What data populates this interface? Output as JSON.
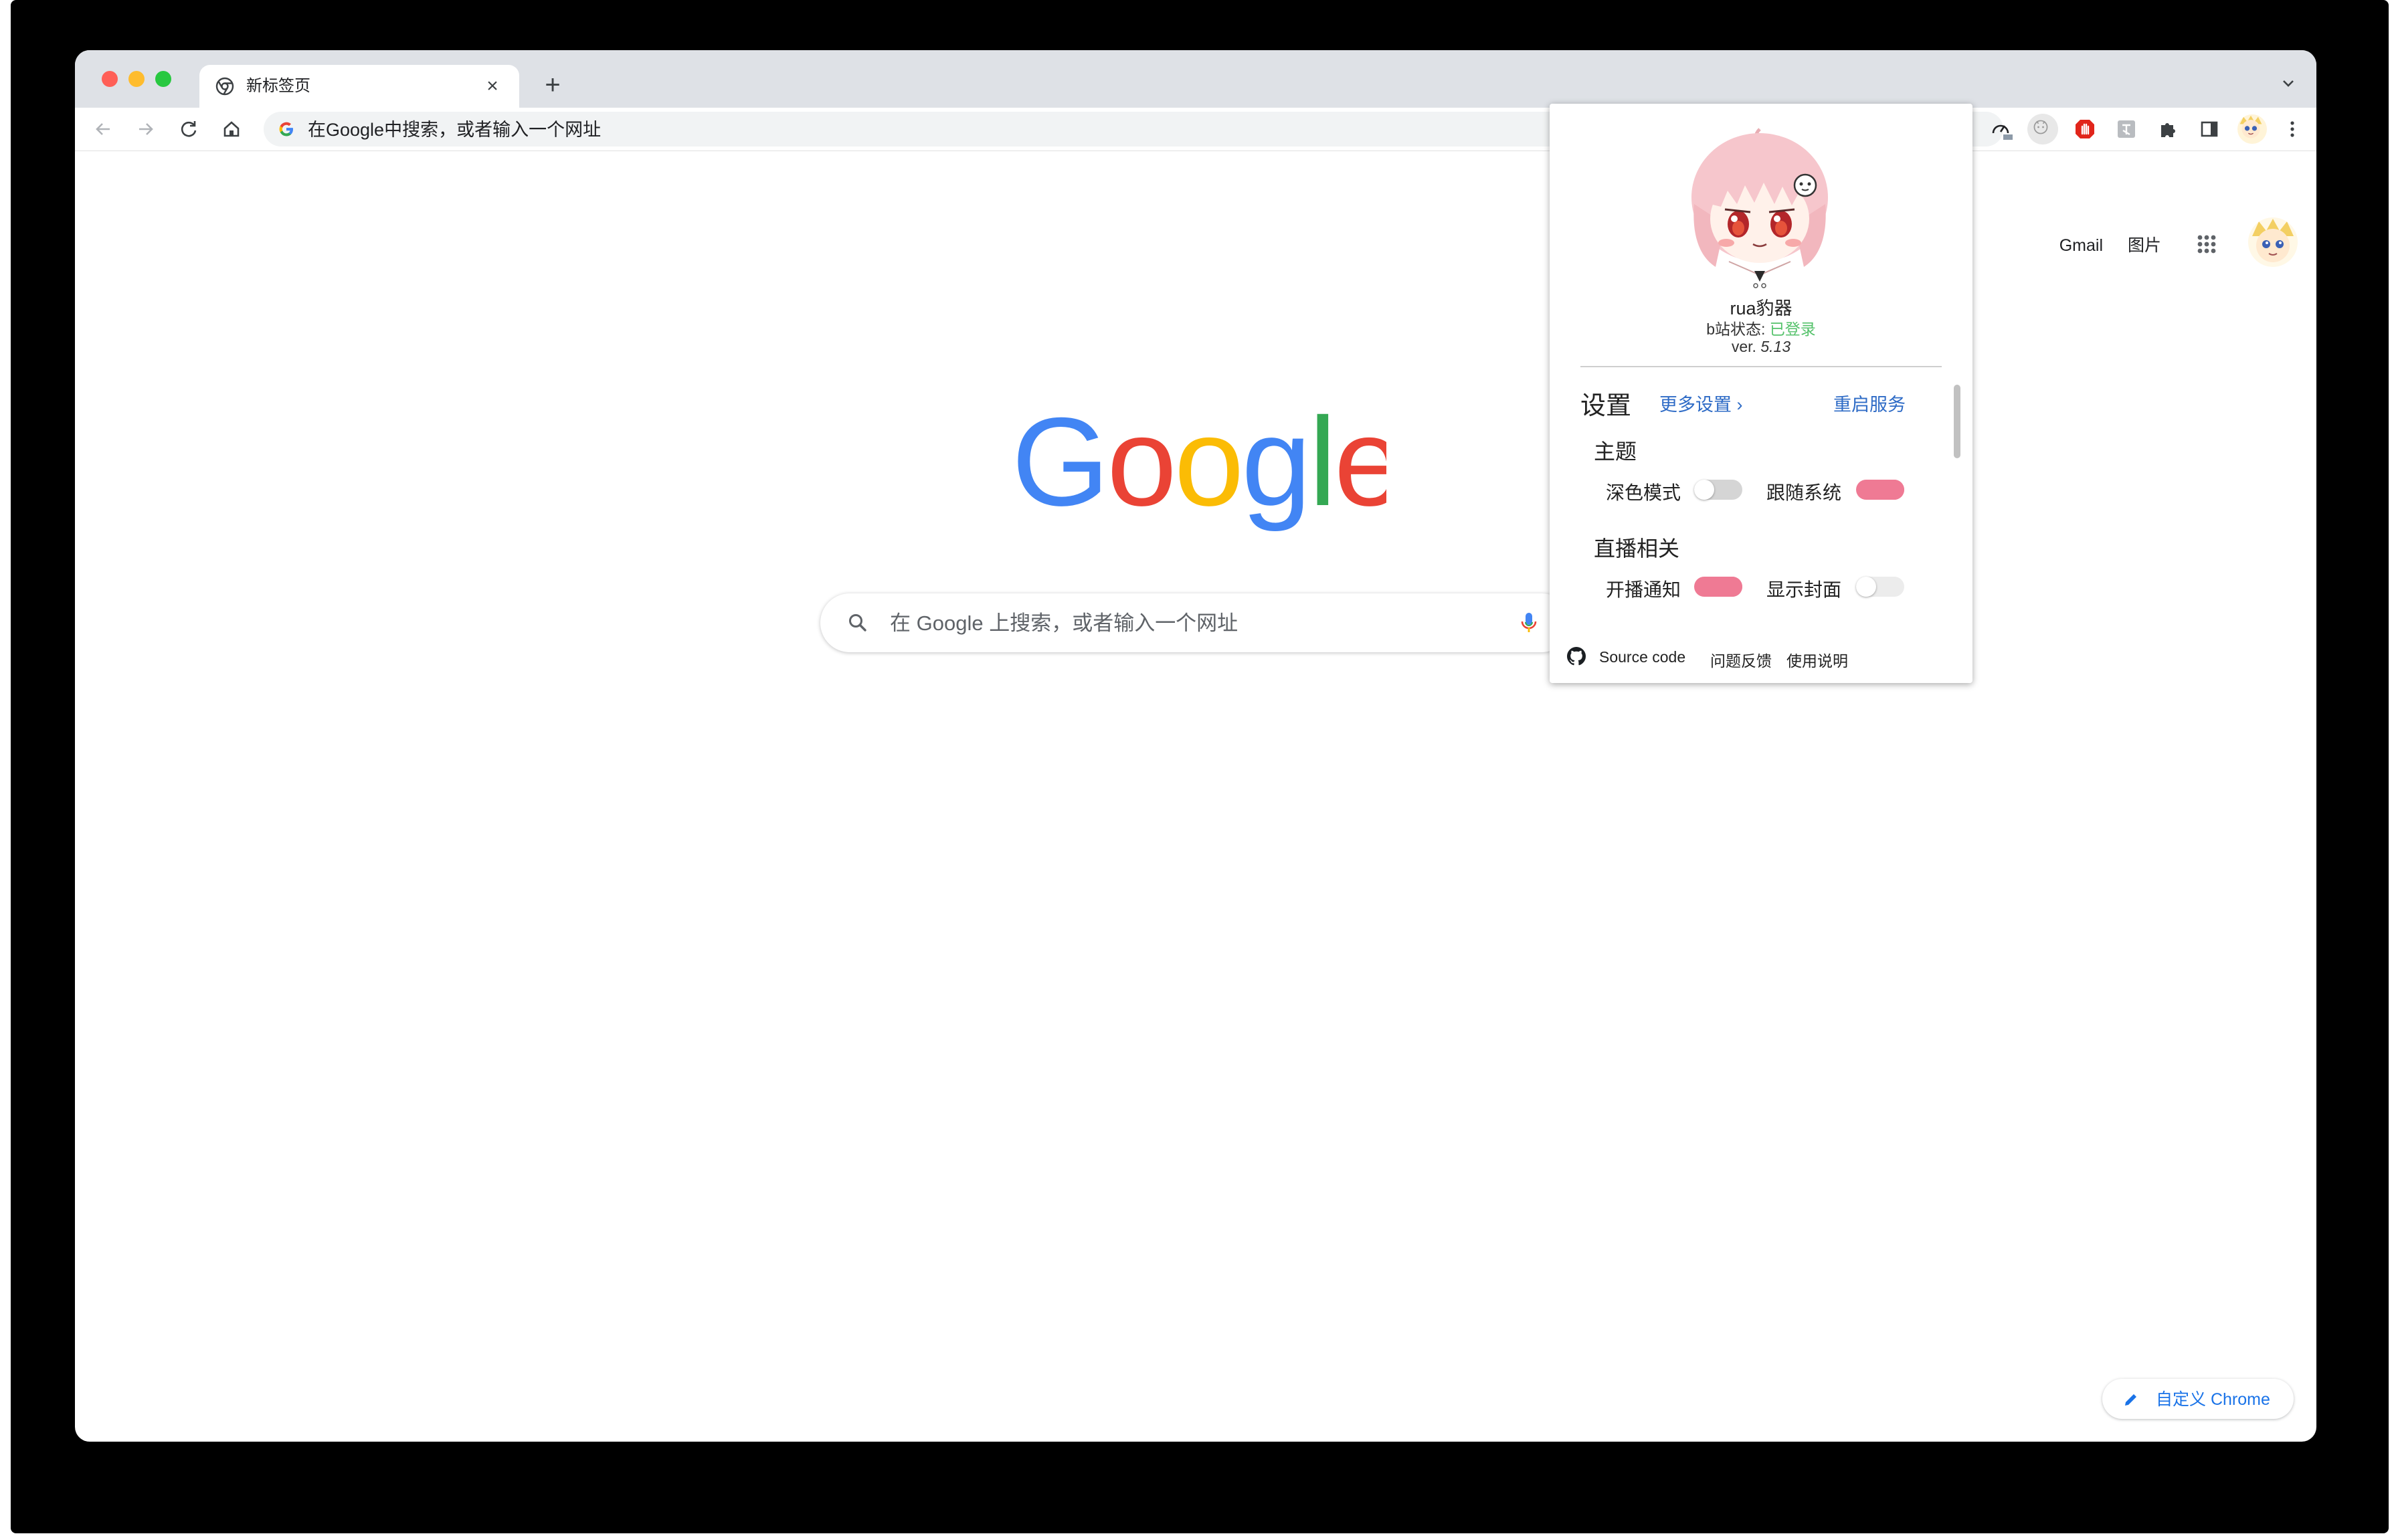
{
  "tab": {
    "title": "新标签页"
  },
  "omnibox": {
    "placeholder": "在Google中搜索，或者输入一个网址"
  },
  "ntp": {
    "links": [
      "Gmail",
      "图片"
    ],
    "search_placeholder": "在 Google 上搜索，或者输入一个网址",
    "customize_label": "自定义 Chrome"
  },
  "popup": {
    "name": "rua豹器",
    "status_label": "b站状态: ",
    "status_value": "已登录",
    "version_label": "ver. ",
    "version_value": "5.13",
    "settings_title": "设置",
    "more_settings": "更多设置 ›",
    "restart": "重启服务",
    "theme_heading": "主题",
    "dark_mode_label": "深色模式",
    "dark_mode_on": false,
    "follow_system_label": "跟随系统",
    "follow_system_on": true,
    "live_heading": "直播相关",
    "live_notify_label": "开播通知",
    "live_notify_on": true,
    "show_cover_label": "显示封面",
    "show_cover_on": false,
    "footer": {
      "source": "Source code",
      "feedback": "问题反馈",
      "help": "使用说明"
    }
  },
  "colors": {
    "accent_pink": "#ef7a94",
    "link_blue": "#2e6bc6",
    "status_green": "#55c26b",
    "chrome_blue": "#1a73e8"
  },
  "icons": {
    "back": "arrow-left-icon",
    "forward": "arrow-right-icon",
    "reload": "reload-icon",
    "home": "home-icon",
    "share": "share-icon",
    "star": "star-icon",
    "extensions": "puzzle-icon",
    "side_panel": "side-panel-icon",
    "menu": "kebab-menu-icon",
    "apps": "apps-grid-icon",
    "mic": "mic-icon",
    "pencil": "pencil-icon",
    "github": "github-icon"
  }
}
